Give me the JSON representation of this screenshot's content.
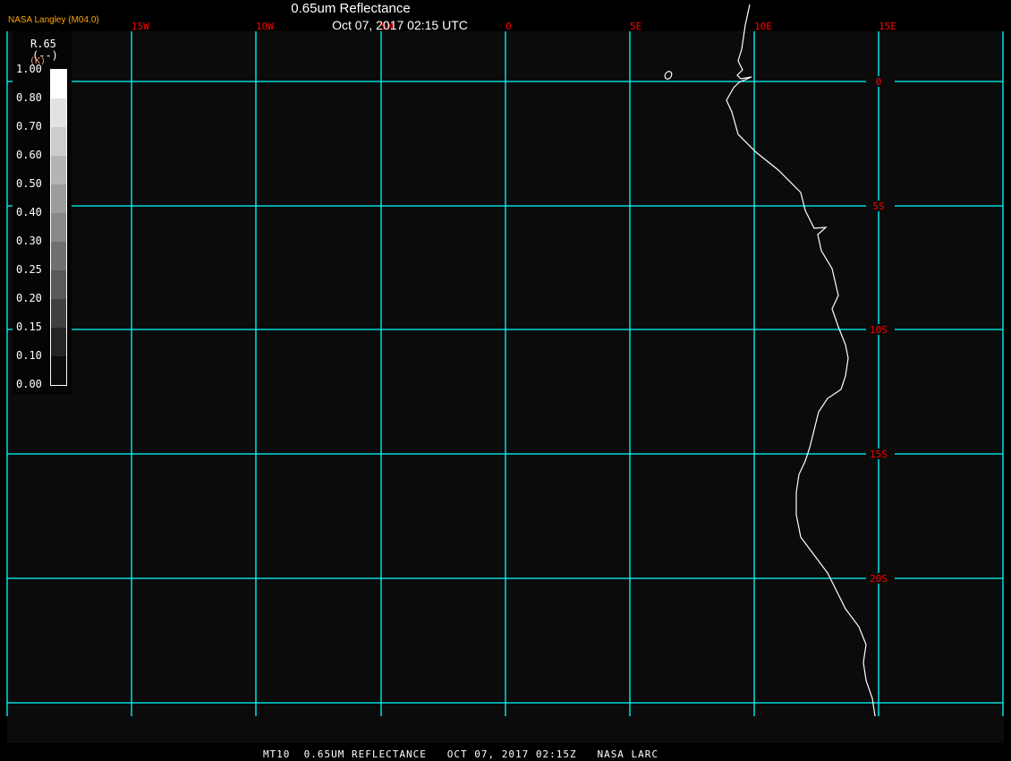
{
  "header": {
    "title": "0.65um Reflectance",
    "datetime": "Oct 07, 2017 02:15 UTC",
    "provider": "NASA Langley (M04.0)"
  },
  "footer": {
    "caption": "MT10  0.65UM REFLECTANCE   OCT 07, 2017 02:15Z   NASA LARC"
  },
  "legend": {
    "variable": "R.65",
    "units": "(--)",
    "units_alt": "(K)",
    "ticks": [
      "1.00",
      "0.80",
      "0.70",
      "0.60",
      "0.50",
      "0.40",
      "0.30",
      "0.25",
      "0.20",
      "0.15",
      "0.10",
      "0.00"
    ],
    "colors": [
      "#ffffff",
      "#e2e2e2",
      "#cccccc",
      "#b4b4b4",
      "#9c9c9c",
      "#888888",
      "#707070",
      "#5a5a5a",
      "#404040",
      "#242424",
      "#0c0c0c"
    ]
  },
  "grid": {
    "longitude_labels": [
      "15W",
      "10W",
      "5W",
      "0",
      "5E",
      "10E",
      "15E"
    ],
    "latitude_labels": [
      "0",
      "5S",
      "10S",
      "15S",
      "20S"
    ],
    "grid_color": "#00ffff",
    "label_color": "#ff0000"
  },
  "colors": {
    "background": "#0b0b0b",
    "coastline": "#ffffff"
  }
}
